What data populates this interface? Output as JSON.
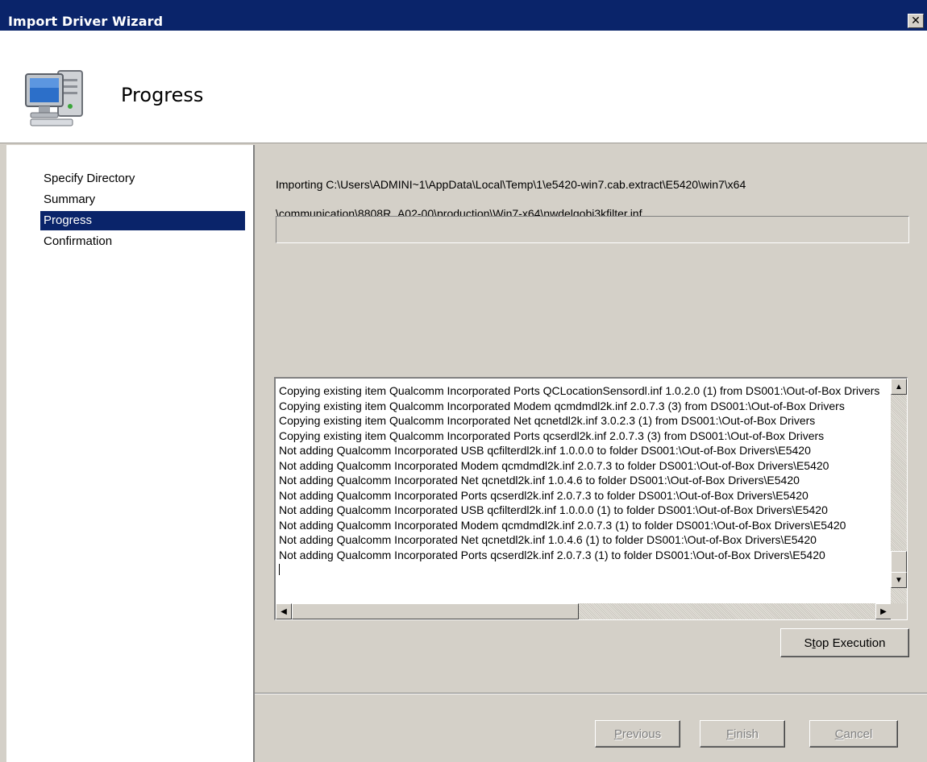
{
  "window": {
    "title": "Import Driver Wizard",
    "close_glyph": "✕"
  },
  "header": {
    "icon": "computer-icon",
    "title": "Progress"
  },
  "nav": {
    "items": [
      {
        "label": "Specify Directory",
        "selected": false
      },
      {
        "label": "Summary",
        "selected": false
      },
      {
        "label": "Progress",
        "selected": true
      },
      {
        "label": "Confirmation",
        "selected": false
      }
    ]
  },
  "content": {
    "status_line1": "Importing C:\\Users\\ADMINI~1\\AppData\\Local\\Temp\\1\\e5420-win7.cab.extract\\E5420\\win7\\x64",
    "status_line2": "\\communication\\8808R_A02-00\\production\\Win7-x64\\nwdelgobi3kfilter.inf",
    "progress": 0,
    "log_lines": [
      "Copying existing item Qualcomm Incorporated Ports QCLocationSensordl.inf 1.0.2.0 (1) from DS001:\\Out-of-Box Drivers",
      "Copying existing item Qualcomm Incorporated Modem qcmdmdl2k.inf 2.0.7.3 (3) from DS001:\\Out-of-Box Drivers",
      "Copying existing item Qualcomm Incorporated Net qcnetdl2k.inf 3.0.2.3 (1) from DS001:\\Out-of-Box Drivers",
      "Copying existing item Qualcomm Incorporated Ports qcserdl2k.inf 2.0.7.3 (3) from DS001:\\Out-of-Box Drivers",
      "Not adding Qualcomm Incorporated USB qcfilterdl2k.inf 1.0.0.0 to folder DS001:\\Out-of-Box Drivers\\E5420",
      "Not adding Qualcomm Incorporated Modem qcmdmdl2k.inf 2.0.7.3 to folder DS001:\\Out-of-Box Drivers\\E5420",
      "Not adding Qualcomm Incorporated Net qcnetdl2k.inf 1.0.4.6 to folder DS001:\\Out-of-Box Drivers\\E5420",
      "Not adding Qualcomm Incorporated Ports qcserdl2k.inf 2.0.7.3 to folder DS001:\\Out-of-Box Drivers\\E5420",
      "Not adding Qualcomm Incorporated USB qcfilterdl2k.inf 1.0.0.0 (1) to folder DS001:\\Out-of-Box Drivers\\E5420",
      "Not adding Qualcomm Incorporated Modem qcmdmdl2k.inf 2.0.7.3 (1) to folder DS001:\\Out-of-Box Drivers\\E5420",
      "Not adding Qualcomm Incorporated Net qcnetdl2k.inf 1.0.4.6 (1) to folder DS001:\\Out-of-Box Drivers\\E5420",
      "Not adding Qualcomm Incorporated Ports qcserdl2k.inf 2.0.7.3 (1) to folder DS001:\\Out-of-Box Drivers\\E5420"
    ],
    "stop_button": {
      "pre": "S",
      "accel": "t",
      "post": "op Execution"
    }
  },
  "footer": {
    "previous": {
      "accel": "P",
      "post": "revious",
      "enabled": false
    },
    "finish": {
      "accel": "F",
      "post": "inish",
      "enabled": false
    },
    "cancel": {
      "accel": "C",
      "post": "ancel",
      "enabled": false
    }
  },
  "scroll": {
    "up": "▲",
    "down": "▼",
    "left": "◀",
    "right": "▶"
  }
}
